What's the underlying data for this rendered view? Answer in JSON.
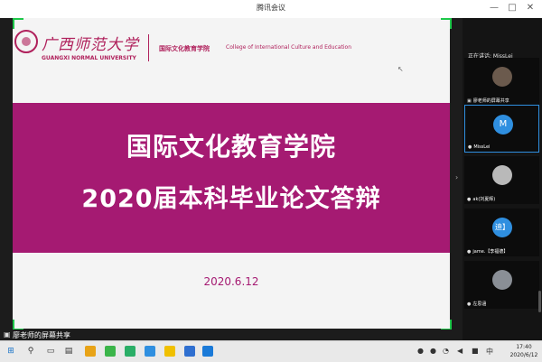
{
  "window": {
    "title": "腾讯会议",
    "controls": [
      "—",
      "□",
      "✕"
    ]
  },
  "slide": {
    "logo_cn": "广西师范大学",
    "logo_en": "GUANGXI NORMAL UNIVERSITY",
    "college_cn": "国际文化教育学院",
    "college_en": "College of International Culture and Education",
    "title_line1": "国际文化教育学院",
    "title_line2": "2020届本科毕业论文答辩",
    "date": "2020.6.12",
    "accent_color": "#a51a72"
  },
  "share_status": "廖老师的屏幕共享",
  "sidebar": {
    "speaking_label": "正在讲话: MissLei",
    "participants": [
      {
        "name": "廖老师的屏幕共享",
        "avatar": "",
        "avatar_color": "#6b5a4d"
      },
      {
        "name": "MissLei",
        "avatar": "M",
        "avatar_color": "#2f8fe0",
        "active": true
      },
      {
        "name": "ak(刘夏辉)",
        "avatar": "",
        "avatar_color": "#b9b9b9"
      },
      {
        "name": "jame.【李福德】",
        "avatar": "迪】",
        "avatar_color": "#2f8fe0"
      },
      {
        "name": "左思涵",
        "avatar": "",
        "avatar_color": "#8a8f96"
      }
    ]
  },
  "taskbar": {
    "language": "中",
    "time": "17:40",
    "date": "2020/6/12"
  }
}
